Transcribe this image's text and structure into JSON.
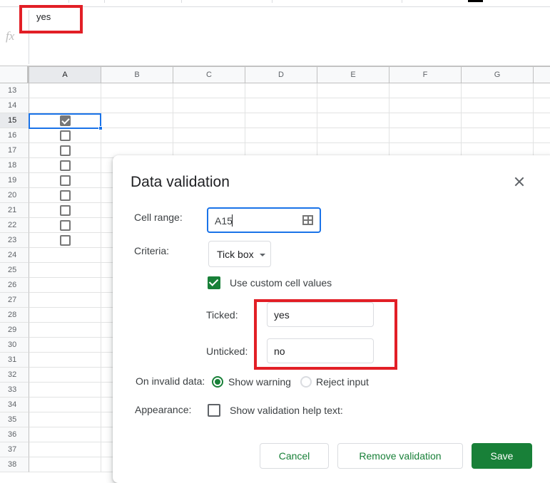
{
  "formula_bar": {
    "fx_label": "fx",
    "value": "yes"
  },
  "sheet": {
    "columns": [
      "A",
      "B",
      "C",
      "D",
      "E",
      "F",
      "G"
    ],
    "selected_column": "A",
    "rows": [
      "13",
      "14",
      "15",
      "16",
      "17",
      "18",
      "19",
      "20",
      "21",
      "22",
      "23",
      "24",
      "25",
      "26",
      "27",
      "28",
      "29",
      "30",
      "31",
      "32",
      "33",
      "34",
      "35",
      "36",
      "37",
      "38"
    ],
    "selected_row": "15",
    "selected_cell": "A15",
    "column_a_checkboxes": [
      {
        "row": "15",
        "checked": true
      },
      {
        "row": "16",
        "checked": false
      },
      {
        "row": "17",
        "checked": false
      },
      {
        "row": "18",
        "checked": false
      },
      {
        "row": "19",
        "checked": false
      },
      {
        "row": "20",
        "checked": false
      },
      {
        "row": "21",
        "checked": false
      },
      {
        "row": "22",
        "checked": false
      },
      {
        "row": "23",
        "checked": false
      }
    ]
  },
  "dialog": {
    "title": "Data validation",
    "close_icon": "close-icon",
    "cell_range_label": "Cell range:",
    "cell_range_value": "A15",
    "criteria_label": "Criteria:",
    "criteria_value": "Tick box",
    "use_custom_values_label": "Use custom cell values",
    "use_custom_values_checked": true,
    "ticked_label": "Ticked:",
    "ticked_value": "yes",
    "unticked_label": "Unticked:",
    "unticked_value": "no",
    "invalid_data_label": "On invalid data:",
    "invalid_options": [
      {
        "label": "Show warning",
        "selected": true
      },
      {
        "label": "Reject input",
        "selected": false
      }
    ],
    "appearance_label": "Appearance:",
    "help_text_label": "Show validation help text:",
    "help_text_checked": false,
    "buttons": {
      "cancel": "Cancel",
      "remove": "Remove validation",
      "save": "Save"
    }
  },
  "colors": {
    "accent_green": "#188038",
    "selection_blue": "#1a73e8",
    "annotation_red": "#e21f26"
  }
}
